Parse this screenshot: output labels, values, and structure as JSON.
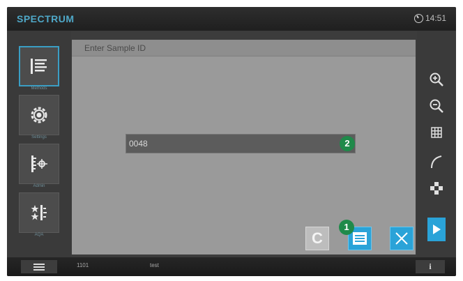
{
  "app": {
    "brand": "SPECTRUM",
    "time": "14:51"
  },
  "sidebar": {
    "items": [
      {
        "label": "Methods",
        "icon": "methods-list-icon",
        "active": true
      },
      {
        "label": "Settings",
        "icon": "settings-gear-icon",
        "active": false
      },
      {
        "label": "Admin",
        "icon": "admin-ruler-icon",
        "active": false
      },
      {
        "label": "AQA",
        "icon": "aqa-stars-icon",
        "active": false
      }
    ]
  },
  "dialog": {
    "title": "Enter Sample ID",
    "sample_id_value": "0048",
    "clear_label": "C",
    "save_icon": "save-icon",
    "close_icon": "close-icon"
  },
  "annotations": {
    "callout_1": "1",
    "callout_2": "2",
    "color": "#1f8a4a"
  },
  "toolbar": {
    "icons": [
      "zoom-in-icon",
      "zoom-out-icon",
      "grid-icon",
      "curve-icon",
      "pattern-icon",
      "play-icon"
    ]
  },
  "statusbar": {
    "menu_icon": "hamburger-menu-icon",
    "code": "1101",
    "user": "test",
    "info_label": "i"
  },
  "colors": {
    "accent": "#2aa3d8",
    "brand": "#4fa8c8",
    "dialog_bg": "#9a9a9a",
    "frame": "#3c3c3c"
  }
}
